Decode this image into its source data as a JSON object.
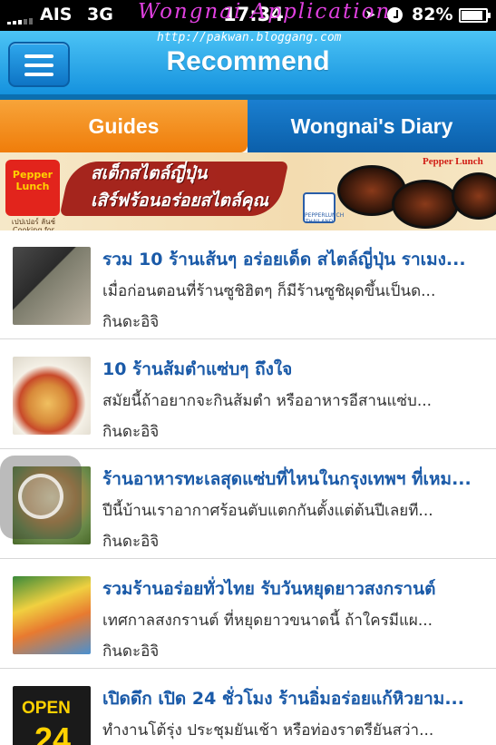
{
  "status_bar": {
    "carrier": "AIS",
    "network": "3G",
    "time": "17:34",
    "battery": "82%"
  },
  "watermark": {
    "title": "Wongnai Application",
    "url": "http://pakwan.bloggang.com"
  },
  "navbar": {
    "title": "Recommend"
  },
  "tabs": [
    {
      "label": "Guides",
      "active": true
    },
    {
      "label": "Wongnai's Diary",
      "active": false
    }
  ],
  "banner": {
    "headline_line1": "สเต็กสไตล์ญี่ปุ่น",
    "headline_line2": "เสิร์ฟร้อนอร่อยสไตล์คุณ",
    "brand": "Pepper Lunch",
    "logo_text": "Pepper Lunch",
    "logo_subtext": "เปปเปอร์ ลันช์ Cooking for FUN",
    "badge_text": "PEPPERLUNCH THAILAND"
  },
  "list": [
    {
      "title": "รวม 10  ร้านเส้นๆ อร่อยเด็ด สไตล์ญี่ปุ่น ราเมง...",
      "description": "เมื่อก่อนตอนที่ร้านซูชิฮิตๆ ก็มีร้านซูชิผุดขึ้นเป็นด...",
      "author": "กินดะอิจิ"
    },
    {
      "title": "10 ร้านส้มตำแซ่บๆ ถึงใจ",
      "description": "สมัยนี้ถ้าอยากจะกินส้มตำ หรืออาหารอีสานแซ่บ...",
      "author": "กินดะอิจิ"
    },
    {
      "title": "ร้านอาหารทะเลสุดแซ่บที่ไหนในกรุงเทพฯ ที่เหม...",
      "description": "ปีนี้บ้านเราอากาศร้อนตับแตกกันตั้งแต่ต้นปีเลยที...",
      "author": "กินดะอิจิ"
    },
    {
      "title": "รวมร้านอร่อยทั่วไทย รับวันหยุดยาวสงกรานต์",
      "description": "เทศกาลสงกรานต์ ที่หยุดยาวขนาดนี้ ถ้าใครมีแผ...",
      "author": "กินดะอิจิ"
    },
    {
      "title": "เปิดดึก เปิด 24 ชั่วโมง ร้านอิ่มอร่อยแก้หิวยาม...",
      "description": "ทำงานโต้รุ่ง ประชุมยันเช้า หรือท่องราตรียันสว่า...",
      "author": "",
      "thumb_text_1": "OPEN",
      "thumb_text_2": "24"
    }
  ],
  "colors": {
    "nav_blue": "#1a9be6",
    "tab_active_orange": "#f28c1a",
    "tab_inactive_blue": "#0b5faa",
    "title_blue": "#1a5aa8"
  }
}
